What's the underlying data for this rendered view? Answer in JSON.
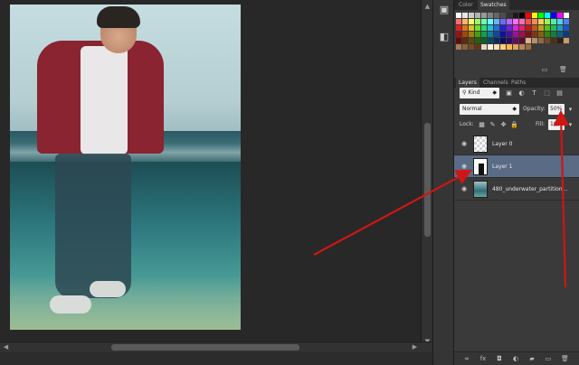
{
  "panel_tabs_top": {
    "color": "Color",
    "swatches": "Swatches"
  },
  "panel_tabs_layers": {
    "layers": "Layers",
    "channels": "Channels",
    "paths": "Paths"
  },
  "filter": {
    "kind_label": "Kind"
  },
  "blend": {
    "mode": "Normal",
    "opacity_label": "Opacity:",
    "opacity_value": "50%"
  },
  "lock": {
    "label": "Lock:",
    "fill_label": "Fill:",
    "fill_value": "100%"
  },
  "layers": [
    {
      "name": "Layer 0"
    },
    {
      "name": "Layer 1"
    },
    {
      "name": "480_underwater_partition..."
    }
  ],
  "annotation_color": "#d01515",
  "selected_layer_color": "#596b85",
  "icons": [
    "eye-icon",
    "link-icon",
    "fx-icon",
    "mask-icon",
    "adjustment-icon",
    "folder-icon",
    "new-layer-icon",
    "trash-icon"
  ],
  "swatch_colors": [
    "#ffffff",
    "#e6e6e6",
    "#cccccc",
    "#b3b3b3",
    "#999999",
    "#808080",
    "#666666",
    "#4d4d4d",
    "#333333",
    "#1a1a1a",
    "#000000",
    "#ff0000",
    "#ffff00",
    "#00ff00",
    "#00ffff",
    "#0000ff",
    "#ff00ff",
    "#ffffff",
    "#ff6a6a",
    "#ffb36a",
    "#ffff6a",
    "#9cff6a",
    "#6affb3",
    "#6affff",
    "#6ab3ff",
    "#6a6aff",
    "#b36aff",
    "#ff6aff",
    "#ff6ab3",
    "#f25050",
    "#f28c50",
    "#f2d250",
    "#a0f250",
    "#50f2a0",
    "#50d2f2",
    "#5080f2",
    "#e02020",
    "#e07020",
    "#e0c020",
    "#70e020",
    "#20e070",
    "#20c0e0",
    "#2070e0",
    "#2020e0",
    "#7020e0",
    "#e020e0",
    "#e02070",
    "#c01818",
    "#c05818",
    "#c0a018",
    "#58c018",
    "#18c058",
    "#18a0c0",
    "#1858c0",
    "#a01010",
    "#a04810",
    "#a08010",
    "#48a010",
    "#10a048",
    "#1080a0",
    "#1048a0",
    "#1010a0",
    "#4810a0",
    "#a010a0",
    "#a01048",
    "#801010",
    "#803810",
    "#806010",
    "#388010",
    "#108038",
    "#106080",
    "#103880",
    "#600c0c",
    "#602a0c",
    "#60480c",
    "#2a600c",
    "#0c602a",
    "#0c4860",
    "#0c2a60",
    "#0c0c60",
    "#2a0c60",
    "#600c60",
    "#600c2a",
    "#d9b38c",
    "#b38f6a",
    "#8f6a47",
    "#6a4a2a",
    "#4a321a",
    "#2e1f0f",
    "#c69c6d",
    "#a67c52",
    "#8c6239",
    "#754c24",
    "#603913",
    "#ead7c3",
    "#fff3e0",
    "#ffe0b2",
    "#ffcc80",
    "#ffb74d",
    "#e6a15c",
    "#b7865a",
    "#9c6b3c"
  ]
}
